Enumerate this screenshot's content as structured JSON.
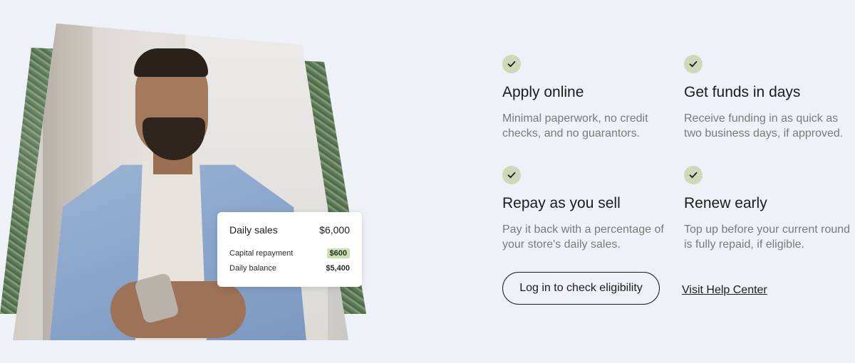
{
  "card": {
    "daily_sales_label": "Daily sales",
    "daily_sales_value": "$6,000",
    "repayment_label": "Capital repayment",
    "repayment_value": "$600",
    "balance_label": "Daily balance",
    "balance_value": "$5,400"
  },
  "features": [
    {
      "icon": "check-icon",
      "title": "Apply online",
      "description": "Minimal paperwork, no credit checks, and no guarantors."
    },
    {
      "icon": "check-icon",
      "title": "Get funds in days",
      "description": "Receive funding in as quick as two business days, if approved."
    },
    {
      "icon": "check-icon",
      "title": "Repay as you sell",
      "description": "Pay it back with a percentage of your store's daily sales."
    },
    {
      "icon": "check-icon",
      "title": "Renew early",
      "description": "Top up before your current round is fully repaid, if eligible."
    }
  ],
  "actions": {
    "login_button": "Log in to check eligibility",
    "help_link": "Visit Help Center"
  },
  "colors": {
    "background": "#eef2f8",
    "check_badge": "#cdd9b9",
    "highlight": "#cbe2b0"
  }
}
